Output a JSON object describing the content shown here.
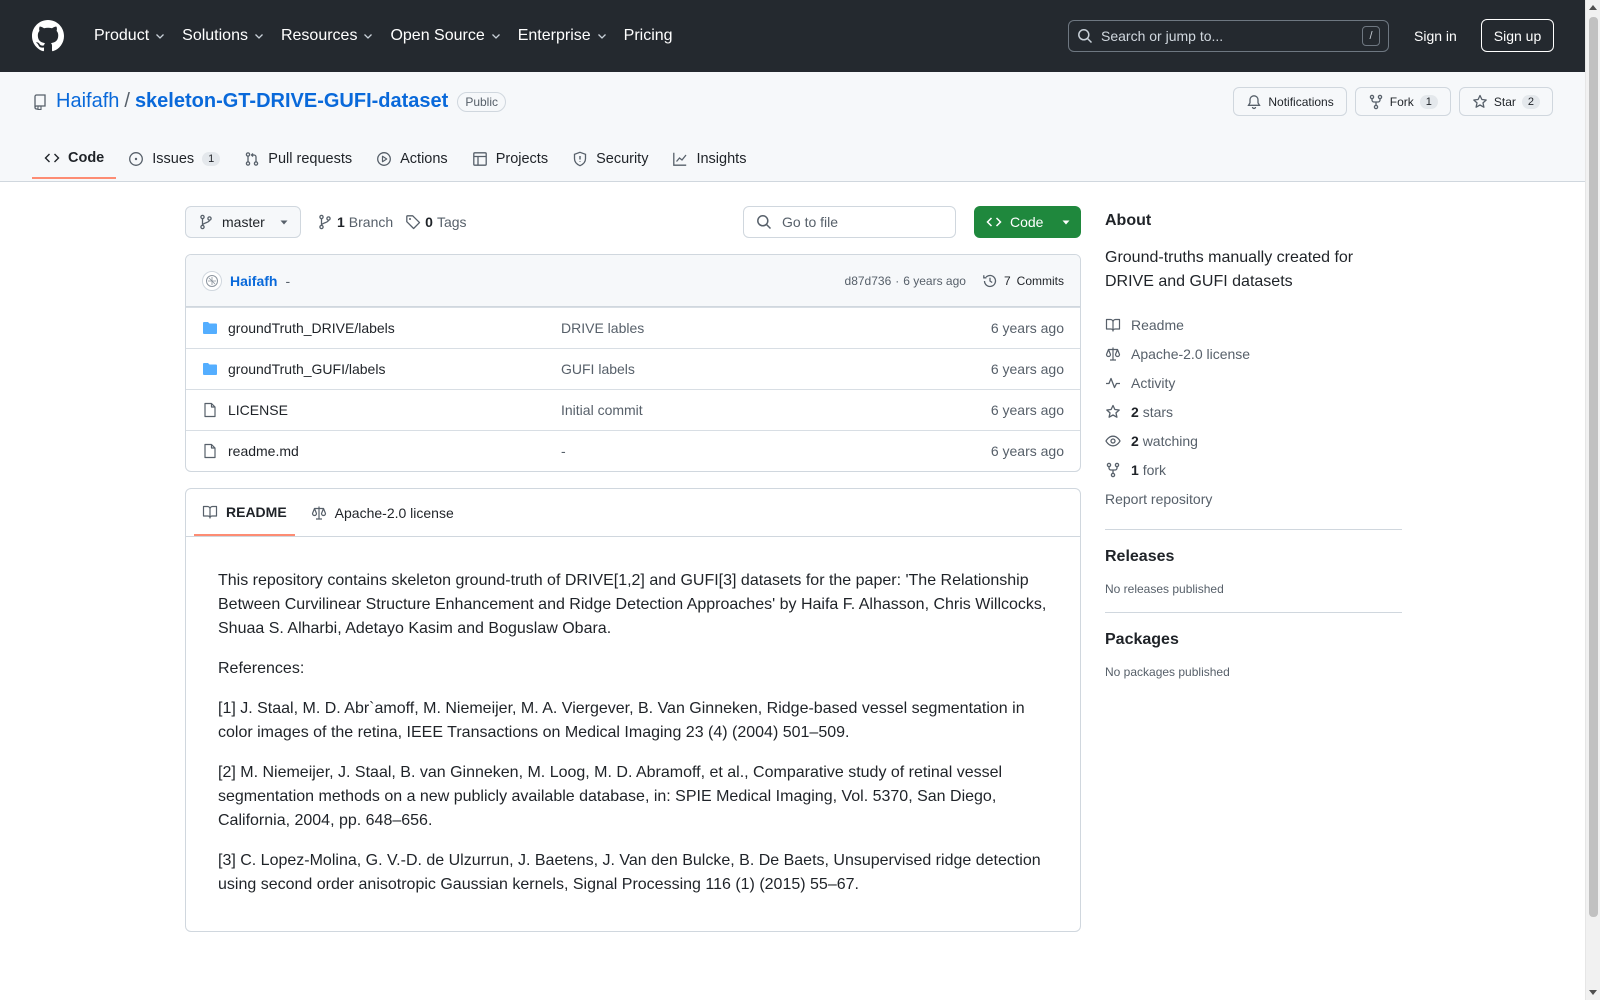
{
  "header": {
    "nav": [
      {
        "label": "Product",
        "dropdown": true
      },
      {
        "label": "Solutions",
        "dropdown": true
      },
      {
        "label": "Resources",
        "dropdown": true
      },
      {
        "label": "Open Source",
        "dropdown": true
      },
      {
        "label": "Enterprise",
        "dropdown": true
      },
      {
        "label": "Pricing",
        "dropdown": false
      }
    ],
    "search_placeholder": "Search or jump to...",
    "search_key": "/",
    "sign_in": "Sign in",
    "sign_up": "Sign up"
  },
  "repo": {
    "owner": "Haifafh",
    "separator": "/",
    "name": "skeleton-GT-DRIVE-GUFI-dataset",
    "visibility": "Public",
    "notifications_label": "Notifications",
    "fork_label": "Fork",
    "fork_count": "1",
    "star_label": "Star",
    "star_count": "2",
    "tabs": [
      {
        "label": "Code",
        "icon": "code-icon",
        "active": true,
        "counter": ""
      },
      {
        "label": "Issues",
        "icon": "issue-icon",
        "active": false,
        "counter": "1"
      },
      {
        "label": "Pull requests",
        "icon": "pull-request-icon",
        "active": false,
        "counter": ""
      },
      {
        "label": "Actions",
        "icon": "play-icon",
        "active": false,
        "counter": ""
      },
      {
        "label": "Projects",
        "icon": "table-icon",
        "active": false,
        "counter": ""
      },
      {
        "label": "Security",
        "icon": "shield-icon",
        "active": false,
        "counter": ""
      },
      {
        "label": "Insights",
        "icon": "graph-icon",
        "active": false,
        "counter": ""
      }
    ]
  },
  "toolbar": {
    "branch": "master",
    "branch_count": "1",
    "branch_label": "Branch",
    "tag_count": "0",
    "tag_label": "Tags",
    "goto_placeholder": "Go to file",
    "code_button": "Code"
  },
  "commit": {
    "author": "Haifafh",
    "message": "-",
    "hash": "d87d736",
    "dot": "·",
    "time": "6 years ago",
    "commits_count": "7",
    "commits_label": "Commits"
  },
  "files": [
    {
      "type": "folder",
      "name": "groundTruth_DRIVE/labels",
      "commit": "DRIVE lables",
      "date": "6 years ago"
    },
    {
      "type": "folder",
      "name": "groundTruth_GUFI/labels",
      "commit": "GUFI labels",
      "date": "6 years ago"
    },
    {
      "type": "file",
      "name": "LICENSE",
      "commit": "Initial commit",
      "date": "6 years ago"
    },
    {
      "type": "file",
      "name": "readme.md",
      "commit": "-",
      "date": "6 years ago"
    }
  ],
  "readme": {
    "tab_readme": "README",
    "tab_license": "Apache-2.0 license",
    "paragraphs": [
      "This repository contains skeleton ground-truth of DRIVE[1,2] and GUFI[3] datasets for the paper: 'The Relationship Between Curvilinear Structure Enhancement and Ridge Detection Approaches' by Haifa F. Alhasson, Chris Willcocks, Shuaa S. Alharbi, Adetayo Kasim and Boguslaw Obara.",
      "References:",
      "[1] J. Staal, M. D. Abr`amoff, M. Niemeijer, M. A. Viergever, B. Van Ginneken, Ridge-based vessel segmentation in color images of the retina, IEEE Transactions on Medical Imaging 23 (4) (2004) 501–509.",
      "[2] M. Niemeijer, J. Staal, B. van Ginneken, M. Loog, M. D. Abramoff, et al., Comparative study of retinal vessel segmentation methods on a new publicly available database, in: SPIE Medical Imaging, Vol. 5370, San Diego, California, 2004, pp. 648–656.",
      "[3] C. Lopez-Molina, G. V.-D. de Ulzurrun, J. Baetens, J. Van den Bulcke, B. De Baets, Unsupervised ridge detection using second order anisotropic Gaussian kernels, Signal Processing 116 (1) (2015) 55–67."
    ]
  },
  "about": {
    "title": "About",
    "description": "Ground-truths manually created for DRIVE and GUFI datasets",
    "readme": "Readme",
    "license": "Apache-2.0 license",
    "activity": "Activity",
    "stars_count": "2",
    "stars_label": "stars",
    "watching_count": "2",
    "watching_label": "watching",
    "forks_count": "1",
    "forks_label": "fork",
    "report": "Report repository"
  },
  "releases": {
    "title": "Releases",
    "empty": "No releases published"
  },
  "packages": {
    "title": "Packages",
    "empty": "No packages published"
  },
  "colors": {
    "header_bg": "#24292f",
    "link": "#0969da",
    "code_button": "#1f883d",
    "active_tab": "#fd8c73",
    "folder": "#54aeff"
  }
}
